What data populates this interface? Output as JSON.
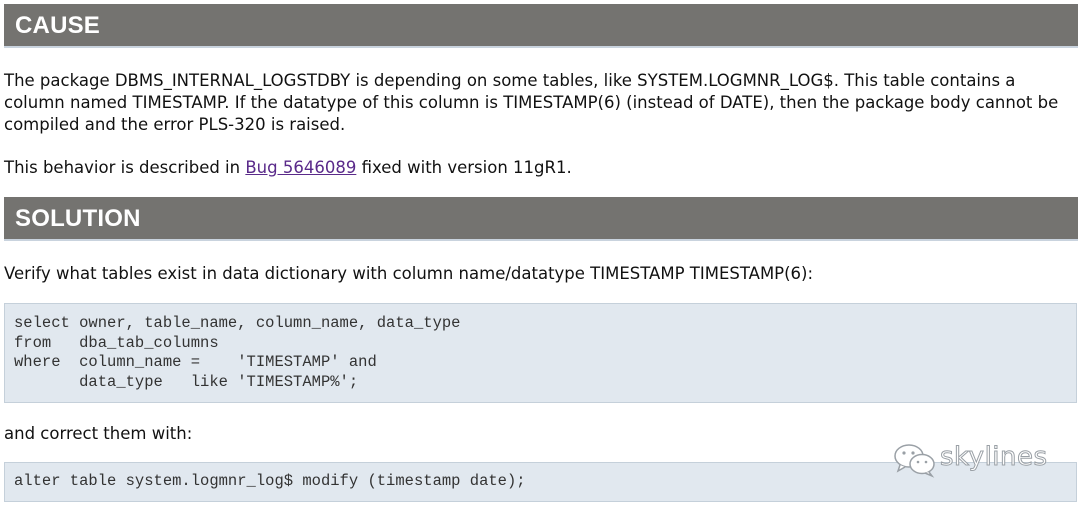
{
  "cause": {
    "heading": "CAUSE",
    "paragraph": "The package DBMS_INTERNAL_LOGSTDBY is depending on some tables, like SYSTEM.LOGMNR_LOG$. This table contains a column named TIMESTAMP. If the datatype of this column is TIMESTAMP(6) (instead of DATE), then the package body cannot be compiled and the error PLS-320 is raised.",
    "behavior_prefix": "This behavior is described in ",
    "bug_link": "Bug 5646089",
    "behavior_suffix": " fixed with version 11gR1."
  },
  "solution": {
    "heading": "SOLUTION",
    "verify_text": "Verify what tables exist in data dictionary with column name/datatype TIMESTAMP TIMESTAMP(6):",
    "query_lines": [
      "select owner, table_name, column_name, data_type",
      "from   dba_tab_columns",
      "where  column_name =    'TIMESTAMP' and",
      "       data_type   like 'TIMESTAMP%';"
    ],
    "correct_text": "and correct them with:",
    "fix_line": "alter table system.logmnr_log$ modify (timestamp date);"
  },
  "watermark": {
    "text": "skylines",
    "icon": "wechat-icon"
  }
}
